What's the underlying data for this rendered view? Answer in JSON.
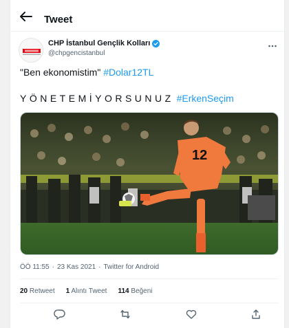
{
  "header": {
    "title": "Tweet",
    "back_icon": "arrow-left-icon"
  },
  "author": {
    "name": "CHP İstanbul Gençlik Kolları",
    "handle": "@chpgencistanbul",
    "verified": true,
    "verified_color": "#1d9bf0",
    "avatar_icon": "chp-logo-avatar"
  },
  "tweet": {
    "line1_text": "\"Ben ekonomistim\"",
    "line1_hashtag": "#Dolar12TL",
    "line2_text": "YÖNETEMİYORSUNUZ",
    "line2_hashtag": "#ErkenSeçim",
    "hashtag_color": "#1d9bf0"
  },
  "media": {
    "alt": "Goalkeeper in orange kit with number 12 kicking a football in a stadium",
    "jersey_number": "12"
  },
  "meta": {
    "time": "ÖÖ 11:55",
    "separator": "·",
    "date": "23 Kas 2021",
    "source": "Twitter for Android"
  },
  "stats": {
    "retweets_count": "20",
    "retweets_label": "Retweet",
    "quotes_count": "1",
    "quotes_label": "Alıntı Tweet",
    "likes_count": "114",
    "likes_label": "Beğeni"
  },
  "actions": [
    "reply-icon",
    "retweet-icon",
    "like-icon",
    "share-icon"
  ]
}
